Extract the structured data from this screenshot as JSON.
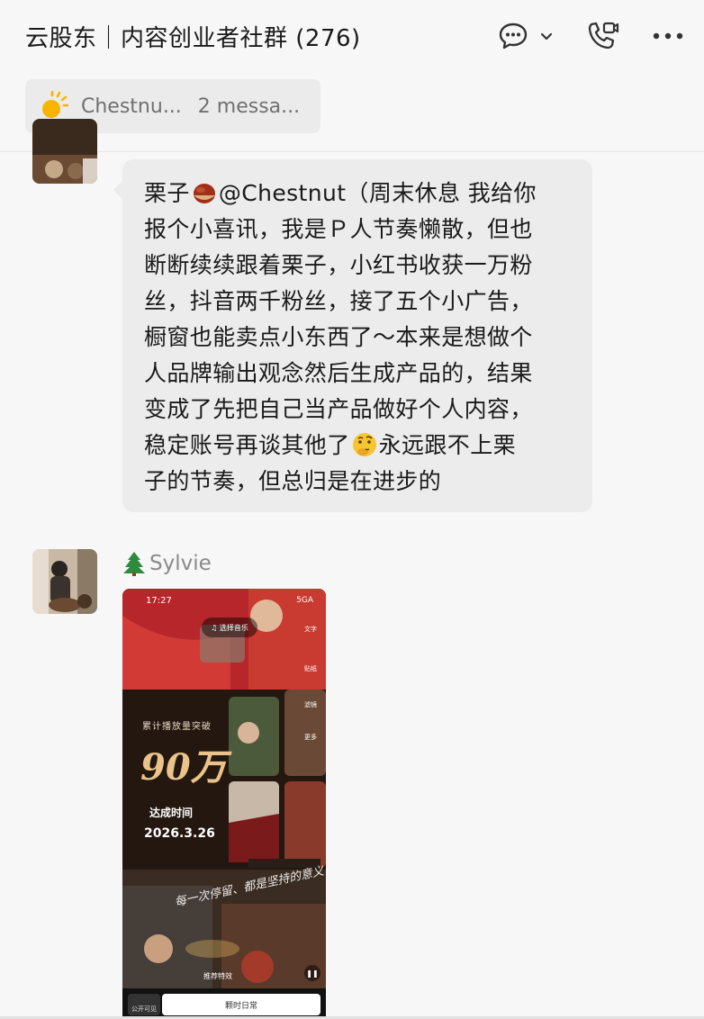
{
  "header": {
    "title": "云股东｜内容创业者社群 (276)",
    "icons": [
      "chat-bubble-icon",
      "chevron-down-icon",
      "video-call-icon",
      "more-icon"
    ]
  },
  "pinned": {
    "sender": "Chestnu...",
    "count": "2 messa..."
  },
  "messages": [
    {
      "text_before_emoji": "栗子",
      "text_after_emoji": "@Chestnut（周末休息 我给你\n报个小喜讯，我是Ｐ人节奏懒散，但也\n断断续续跟着栗子，小红书收获一万粉\n丝，抖音两千粉丝，接了五个小广告，\n橱窗也能卖点小东西了～本来是想做个\n人品牌输出观念然后生成产品的，结果\n变成了先把自己当产品做好个人内容，\n稳定账号再谈其他了",
      "text_end": "永远跟不上栗\n子的节奏，但总归是在进步的",
      "emojis": [
        "chestnut-emoji",
        "thinking-face-emoji"
      ]
    },
    {
      "sender": "Sylvie",
      "sender_icon": "pine-tree-icon",
      "image": {
        "status_time": "17:27",
        "status_right": "5GA",
        "music_label": "选择音乐",
        "stat_label": "累计播放量突破",
        "stat_value": "90万",
        "reach_label": "达成时间",
        "reach_date": "2026.3.26",
        "script_text": "每一次停留、都是坚持的意义",
        "side_tabs": [
          "文字",
          "贴纸",
          "滤镜",
          "更多"
        ],
        "effect_label": "推荐特效",
        "bottom_tab": "颗时日常",
        "bottom_left": "公开可见"
      }
    }
  ]
}
